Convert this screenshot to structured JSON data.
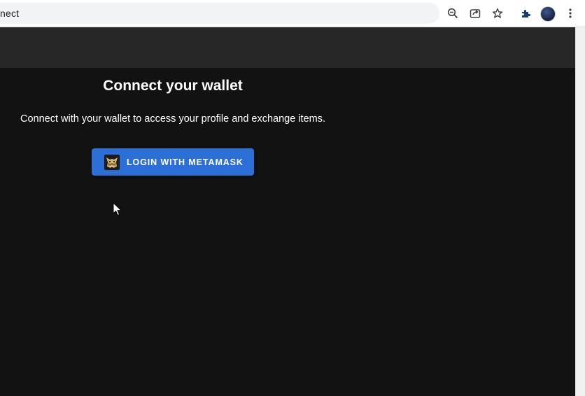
{
  "browser": {
    "url_text": "nect",
    "icons": [
      "zoom-out-icon",
      "share-icon",
      "star-icon",
      "extensions-icon",
      "profile-avatar",
      "more-menu-icon"
    ]
  },
  "main": {
    "title": "Connect your wallet",
    "description": "Connect with your wallet to access your profile and exchange items.",
    "login_button": {
      "label": "LOGIN WITH METAMASK",
      "icon": "metamask-fox-icon",
      "color": "#2c6fd6"
    }
  },
  "colors": {
    "page_background": "#121212",
    "header_background": "#272727",
    "text": "#ffffff"
  }
}
